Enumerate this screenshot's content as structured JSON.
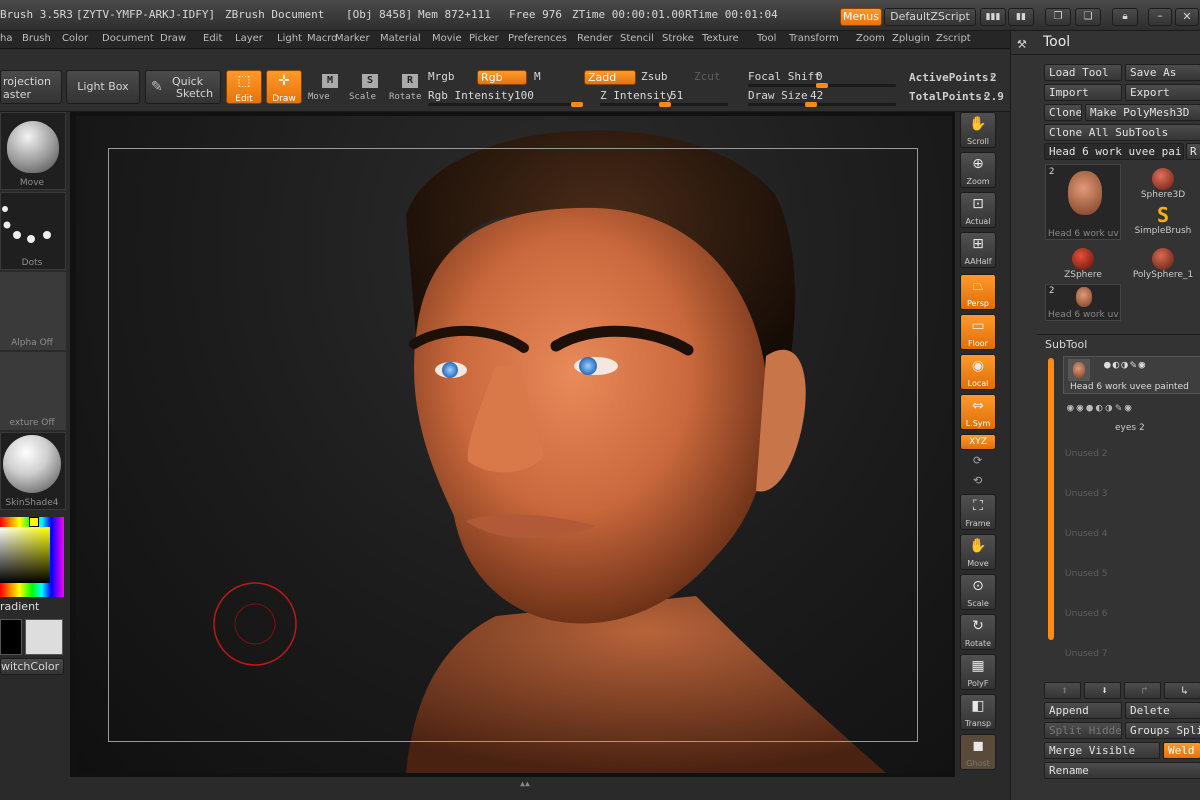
{
  "titlebar": {
    "app": "Brush 3.5R3",
    "serial": "[ZYTV-YMFP-ARKJ-IDFY]",
    "doc": "ZBrush Document",
    "obj": "[Obj 8458]",
    "mem": "Mem 872+111",
    "free": "Free 976",
    "ztime": "ZTime 00:00:01.00",
    "rtime": "RTime 00:01:04",
    "menus_btn": "Menus",
    "script_btn": "DefaultZScript"
  },
  "menubar": [
    "ha",
    "Brush",
    "Color",
    "Document",
    "Draw",
    "Edit",
    "Layer",
    "Light",
    "Macro",
    "Marker",
    "Material",
    "Movie",
    "Picker",
    "Preferences",
    "Render",
    "Stencil",
    "Stroke",
    "Texture",
    "Tool",
    "Transform",
    "Zoom",
    "Zplugin",
    "Zscript"
  ],
  "toolbar": {
    "projection1": "rojection",
    "projection2": "aster",
    "lightbox": "Light Box",
    "quick1": "Quick",
    "quick2": "Sketch",
    "edit": "Edit",
    "draw": "Draw",
    "move": "Move",
    "scale": "Scale",
    "rotate": "Rotate",
    "mrgb": "Mrgb",
    "rgb": "Rgb",
    "m": "M",
    "zadd": "Zadd",
    "zsub": "Zsub",
    "zcut": "Zcut",
    "rgb_intensity_label": "Rgb Intensity",
    "rgb_intensity": "100",
    "z_intensity_label": "Z Intensity",
    "z_intensity": "51",
    "focal_label": "Focal Shift",
    "focal": "0",
    "drawsize_label": "Draw Size",
    "drawsize": "42",
    "active_label": "ActivePoints:",
    "active": "2",
    "total_label": "TotalPoints:",
    "total": "2.9",
    "rgb_intensity_frac": 1.0,
    "z_intensity_frac": 0.51,
    "focal_frac": 0.5,
    "drawsize_frac": 0.42
  },
  "leftshelf": {
    "move": "Move",
    "dots": "Dots",
    "alpha": "Alpha Off",
    "texture": "exture Off",
    "material": "SkinShade4",
    "gradient": "radient",
    "switchcolor": "witchColor"
  },
  "rightshelf": [
    "Scroll",
    "Zoom",
    "Actual",
    "AAHalf",
    "Persp",
    "Floor",
    "Local",
    "L.Sym",
    "XYZ",
    "Frame",
    "Move",
    "Scale",
    "Rotate",
    "PolyF",
    "Transp",
    "Ghost"
  ],
  "tray": {
    "title": "Tool",
    "load": "Load Tool",
    "save": "Save As",
    "import": "Import",
    "export": "Export",
    "clone": "Clone",
    "make_poly": "Make PolyMesh3D",
    "clone_all": "Clone All SubTools",
    "current_tool": "Head 6 work uvee pai",
    "r": "R",
    "tools": [
      {
        "count": "2",
        "name": "Head 6 work uv"
      },
      {
        "count": "",
        "name": "Sphere3D"
      },
      {
        "count": "",
        "name": "SimpleBrush"
      },
      {
        "count": "",
        "name": "ZSphere"
      },
      {
        "count": "",
        "name": "PolySphere_1"
      },
      {
        "count": "2",
        "name": "Head 6 work uv"
      }
    ],
    "subtool_title": "SubTool",
    "subtool_1": "Head 6 work uvee painted",
    "subtool_2": "eyes 2",
    "unused": [
      "Unused 2",
      "Unused 3",
      "Unused 4",
      "Unused 5",
      "Unused 6",
      "Unused 7"
    ],
    "append": "Append",
    "delete": "Delete",
    "split_hidden": "Split Hidden",
    "groups_split": "Groups Split",
    "merge_visible": "Merge Visible",
    "weld": "Weld",
    "rename": "Rename"
  },
  "colors": {
    "accent": "#ff8a14",
    "panel": "#333333",
    "canvas": "#1b1b1b",
    "brush_ring": "#c01818"
  }
}
